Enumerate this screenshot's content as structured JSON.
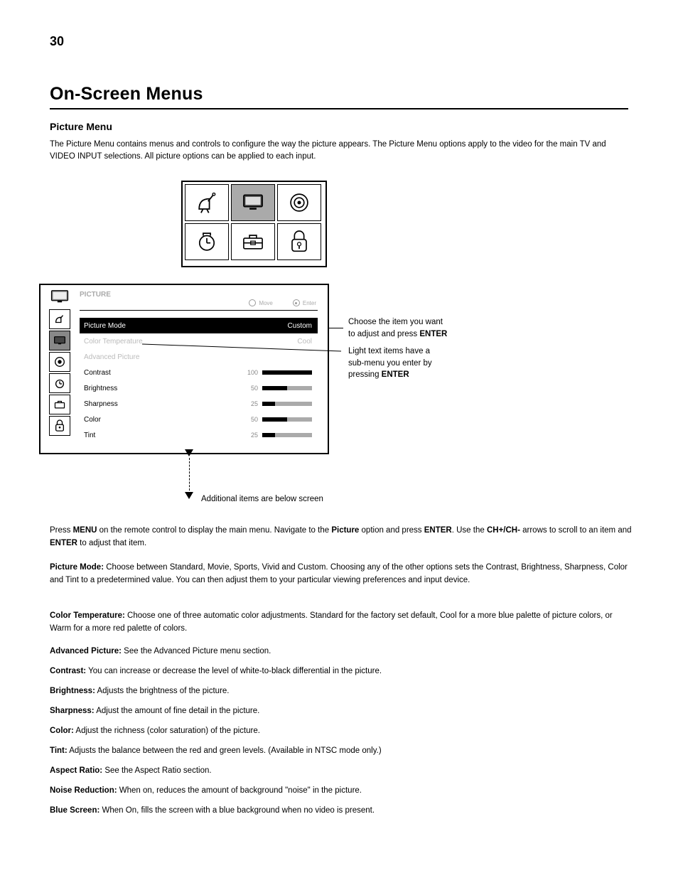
{
  "page_number": "30",
  "section_title": "On-Screen Menus",
  "subheading": "Picture Menu",
  "intro": "The Picture Menu contains menus and controls to configure the way the picture appears. The Picture Menu options apply to the video for the main TV and VIDEO INPUT selections. All picture options can be applied to each input.",
  "grid_icons": [
    "channel",
    "picture",
    "sound",
    "time",
    "setup",
    "lock"
  ],
  "grid_selected_index": 1,
  "osd": {
    "title": "PICTURE",
    "nav_move": "Move",
    "nav_enter": "Enter",
    "side_icons": [
      "channel",
      "picture",
      "sound",
      "time",
      "setup",
      "lock"
    ],
    "side_selected_index": 1,
    "rows": [
      {
        "label": "Picture Mode",
        "value": "Custom",
        "highlight": true
      },
      {
        "label": "Color Temperature",
        "value": "Cool",
        "dim": true
      },
      {
        "label": "Advanced Picture",
        "value": "",
        "dim": true
      },
      {
        "label": "Contrast",
        "value": "100",
        "fill": 100
      },
      {
        "label": "Brightness",
        "value": "50",
        "fill": 50
      },
      {
        "label": "Sharpness",
        "value": "25",
        "fill": 25
      },
      {
        "label": "Color",
        "value": "50",
        "fill": 50
      },
      {
        "label": "Tint",
        "value": "25",
        "fill": 25
      }
    ]
  },
  "callouts": {
    "a_line1": "Choose the item you want",
    "a_line2": "to adjust and press ",
    "a_strong": "ENTER",
    "b_line1": "Light text items have a",
    "b_line2": "sub-menu you enter by",
    "b_line3": "pressing ",
    "b_strong": "ENTER"
  },
  "below_note": "Additional items are below screen",
  "body": {
    "p1_a": "Press ",
    "p1_menu": "MENU",
    "p1_b": " on the remote control to display the main menu. Navigate to the ",
    "p1_pic": "Picture",
    "p1_c": " option and press ",
    "p1_enter": "ENTER",
    "p1_d": ". Use the ",
    "p1_arrow": "CH+/CH-",
    "p1_e": " arrows to scroll to an item and ",
    "p1_enter2": "ENTER",
    "p1_f": " to adjust that item.",
    "pm_label": "Picture Mode:",
    "pm_text": " Choose between Standard, Movie, Sports, Vivid and Custom. Choosing any of the other options sets the Contrast, Brightness, Sharpness, Color and Tint to a predetermined value. You can then adjust them to your particular viewing preferences and input device.",
    "ct_label": "Color Temperature:",
    "ct_text": " Choose one of three automatic color adjustments. Standard for the factory set default, Cool for a more blue palette of picture colors, or Warm for a more red palette of colors.",
    "ap_label": "Advanced Picture:",
    "ap_text": " See the Advanced Picture menu section.",
    "co_label": "Contrast:",
    "co_text": " You can increase or decrease the level of white-to-black differential in the picture.",
    "br_label": "Brightness:",
    "br_text": " Adjusts the brightness of the picture.",
    "sh_label": "Sharpness:",
    "sh_text": " Adjust the amount of fine detail in the picture.",
    "col_label": "Color:",
    "col_text": " Adjust the richness (color saturation) of the picture.",
    "ti_label": "Tint:",
    "ti_text": " Adjusts the balance between the red and green levels. (Available in NTSC mode only.)",
    "ar_label": "Aspect Ratio:",
    "ar_text": " See the Aspect Ratio section.",
    "nr_label": "Noise Reduction:",
    "nr_text": " When on, reduces the amount of background \"noise\" in the picture.",
    "bs_label": "Blue Screen:",
    "bs_text": " When On, fills the screen with a blue background when no video is present."
  }
}
